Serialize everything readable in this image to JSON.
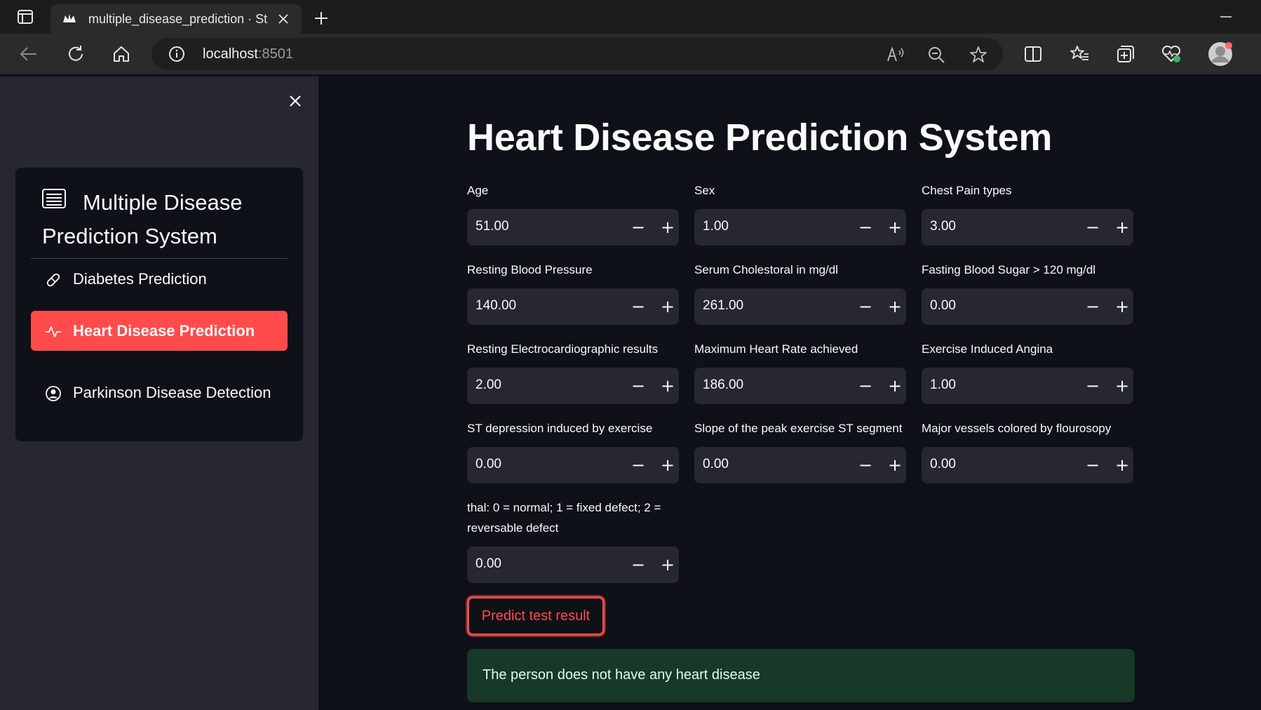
{
  "browser": {
    "tab_title": "multiple_disease_prediction · Stre",
    "url_host": "localhost",
    "url_port": ":8501"
  },
  "sidebar": {
    "menu_title": "Multiple Disease Prediction System",
    "items": [
      {
        "label": "Diabetes Prediction",
        "icon": "capsule-icon",
        "active": false
      },
      {
        "label": "Heart Disease Prediction",
        "icon": "activity-icon",
        "active": true
      },
      {
        "label": "Parkinson Disease Detection",
        "icon": "person-circle-icon",
        "active": false
      }
    ]
  },
  "main": {
    "title": "Heart Disease Prediction System",
    "fields": [
      {
        "label": "Age",
        "value": "51.00"
      },
      {
        "label": "Sex",
        "value": "1.00"
      },
      {
        "label": "Chest Pain types",
        "value": "3.00"
      },
      {
        "label": "Resting Blood Pressure",
        "value": "140.00"
      },
      {
        "label": "Serum Cholestoral in mg/dl",
        "value": "261.00"
      },
      {
        "label": "Fasting Blood Sugar > 120 mg/dl",
        "value": "0.00"
      },
      {
        "label": "Resting Electrocardiographic results",
        "value": "2.00"
      },
      {
        "label": "Maximum Heart Rate achieved",
        "value": "186.00"
      },
      {
        "label": "Exercise Induced Angina",
        "value": "1.00"
      },
      {
        "label": "ST depression induced by exercise",
        "value": "0.00"
      },
      {
        "label": "Slope of the peak exercise ST segment",
        "value": "0.00"
      },
      {
        "label": "Major vessels colored by flourosopy",
        "value": "0.00"
      },
      {
        "label": "thal: 0 = normal; 1 = fixed defect; 2 = reversable defect",
        "value": "0.00"
      }
    ],
    "stepper_minus": "−",
    "stepper_plus": "+",
    "predict_label": "Predict test result",
    "result_text": "The person does not have any heart disease"
  },
  "colors": {
    "accent": "#ff4b4b",
    "background": "#0e1117",
    "sidebar": "#262730",
    "success_bg": "#173928"
  }
}
